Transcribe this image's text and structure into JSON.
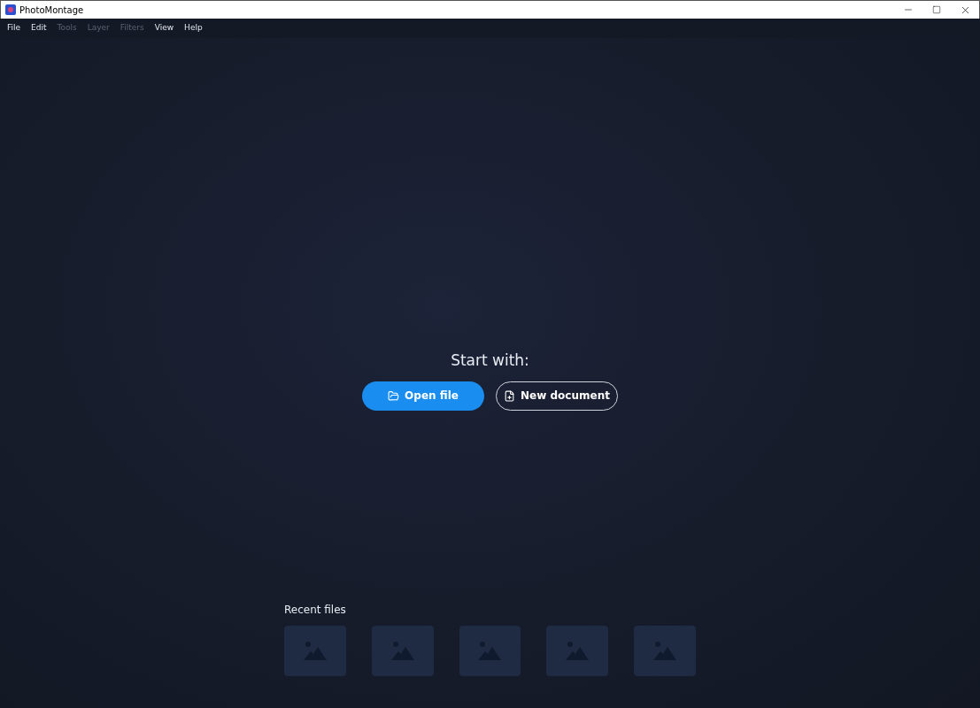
{
  "window": {
    "title": "PhotoMontage"
  },
  "menu": [
    {
      "label": "File",
      "disabled": false
    },
    {
      "label": "Edit",
      "disabled": false
    },
    {
      "label": "Tools",
      "disabled": true
    },
    {
      "label": "Layer",
      "disabled": true
    },
    {
      "label": "Filters",
      "disabled": true
    },
    {
      "label": "View",
      "disabled": false
    },
    {
      "label": "Help",
      "disabled": false
    }
  ],
  "start": {
    "heading": "Start with:",
    "buttons": [
      {
        "label": "Open file",
        "kind": "primary"
      },
      {
        "label": "New document",
        "kind": "outline"
      }
    ]
  },
  "recent_files": {
    "heading": "Recent files",
    "items": [
      {
        "kind": "placeholder"
      },
      {
        "kind": "placeholder"
      },
      {
        "kind": "placeholder"
      },
      {
        "kind": "placeholder"
      },
      {
        "kind": "placeholder"
      }
    ]
  }
}
